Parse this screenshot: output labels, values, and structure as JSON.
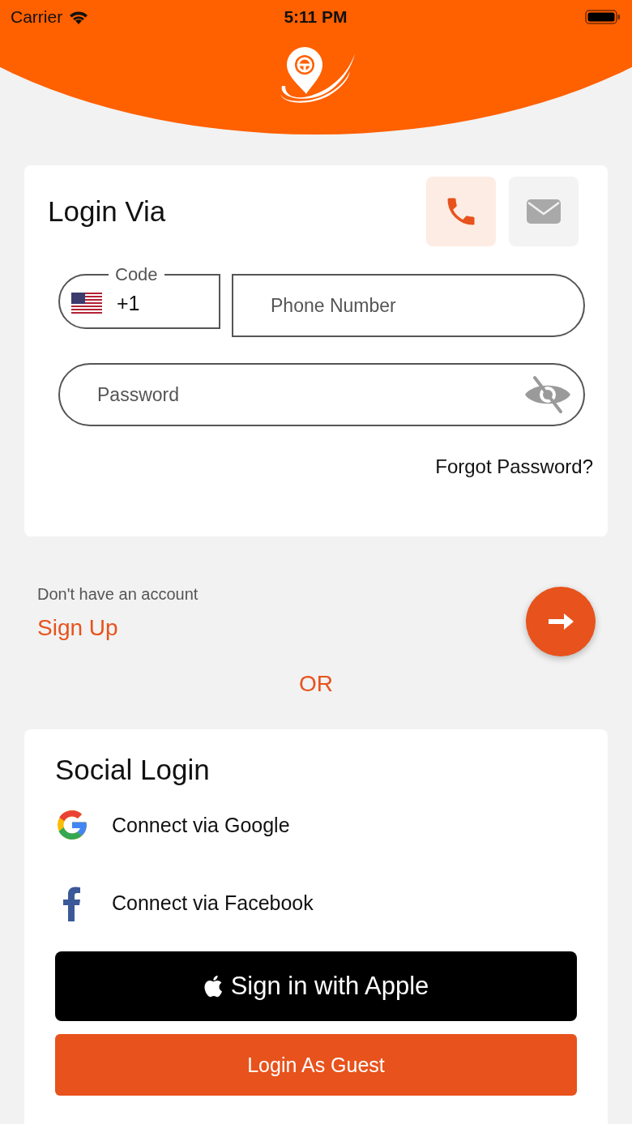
{
  "status_bar": {
    "carrier": "Carrier",
    "time": "5:11 PM"
  },
  "login_card": {
    "title": "Login Via",
    "methods": [
      {
        "kind": "phone",
        "selected": true
      },
      {
        "kind": "email",
        "selected": false
      }
    ],
    "code_field": {
      "label": "Code",
      "value": "+1"
    },
    "phone_field": {
      "placeholder": "Phone Number"
    },
    "password_field": {
      "placeholder": "Password",
      "visible": false
    },
    "forgot_link": "Forgot Password?"
  },
  "signup": {
    "prompt": "Don't have an account",
    "link": "Sign Up"
  },
  "or_label": "OR",
  "social": {
    "title": "Social Login",
    "options": [
      {
        "kind": "google",
        "label": "Connect via Google"
      },
      {
        "kind": "facebook",
        "label": "Connect via Facebook"
      }
    ],
    "apple_button": "Sign in with Apple",
    "guest_button": "Login As Guest"
  }
}
